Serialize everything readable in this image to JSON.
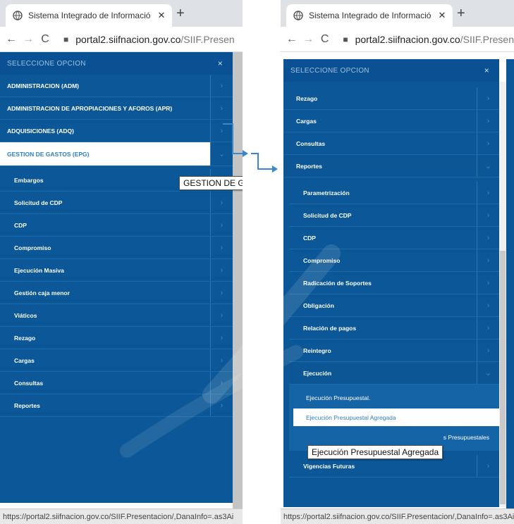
{
  "left": {
    "tab_title": "Sistema Integrado de Informació",
    "url_host": "portal2.siifnacion.gov.co",
    "url_path": "/SIIF.Presen",
    "menu_header": "SELECCIONE OPCION",
    "menu_close": "×",
    "top_items": [
      "ADMINISTRACION (ADM)",
      "ADMINISTRACION DE APROPIACIONES Y AFOROS (APR)",
      "ADQUISICIONES (ADQ)"
    ],
    "selected_item": "GESTION DE GASTOS (EPG)",
    "sub_items": [
      "Embargos",
      "Solicitud de CDP",
      "CDP",
      "Compromiso",
      "Ejecución Masiva",
      "Gestión caja menor",
      "Viáticos",
      "Rezago",
      "Cargas",
      "Consultas",
      "Reportes"
    ],
    "tooltip": "GESTION DE GAS",
    "status": "https://portal2.siifnacion.gov.co/SIIF.Presentacion/,DanaInfo=.as3Ai"
  },
  "right": {
    "tab_title": "Sistema Integrado de Informació",
    "url_host": "portal2.siifnacion.gov.co",
    "url_path": "/SIIF.Presen",
    "menu_header": "SELECCIONE OPCION",
    "menu_close": "×",
    "items": [
      "Rezago",
      "Cargas",
      "Consultas"
    ],
    "expanded_item": "Reportes",
    "report_items": [
      "Parametrización",
      "Solicitud de CDP",
      "CDP",
      "Compromiso",
      "Radicación de Soportes",
      "Obligación",
      "Relación de pagos",
      "Reintegro"
    ],
    "ejecucion_item": "Ejecución",
    "ejecucion_sub": [
      "Ejecución Presupuestal."
    ],
    "ejecucion_selected": "Ejecución Presupuestal Agregada",
    "hidden_item_suffix": "s Presupuestales",
    "vigencias": "Vigencias Futuras",
    "tooltip": "Ejecución Presupuestal Agregada",
    "status": "https://portal2.siifnacion.gov.co/SIIF.Presentacion/,DanaInfo=.as3Ai"
  },
  "icons": {
    "chevron_right": "›",
    "chevron_down": "⌄",
    "back": "←",
    "forward": "→",
    "reload": "C",
    "lock": "🔒",
    "new_tab": "+"
  },
  "colors": {
    "menu_bg": "#0b5797",
    "selected_text": "#2d7fc1",
    "arrow": "#3a86c8"
  }
}
